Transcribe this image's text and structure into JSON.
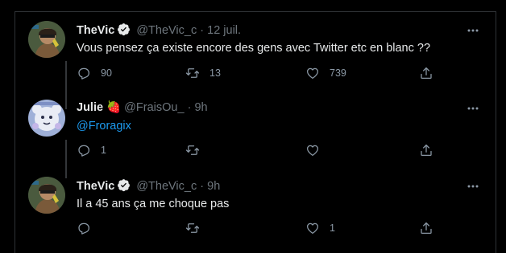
{
  "colors": {
    "background": "#000000",
    "text": "#e7e9ea",
    "secondary": "#6e767d",
    "link": "#1d9bf0",
    "verified": "#ffffff",
    "divider": "#2f3336"
  },
  "tweets": [
    {
      "name": "TheVic",
      "handle": "@TheVic_c",
      "separator": "·",
      "time": "12 juil.",
      "verified": true,
      "text": "Vous pensez ça existe encore des gens avec Twitter etc en blanc ??",
      "reply_count": "90",
      "retweet_count": "13",
      "like_count": "739",
      "icons": [
        "reply-icon",
        "retweet-icon",
        "like-icon",
        "share-icon",
        "more-icon"
      ]
    },
    {
      "name": "Julie",
      "emoji": "🍓",
      "handle": "@FraisOu_",
      "separator": "·",
      "time": "9h",
      "verified": false,
      "mention": "@Froragix",
      "reply_count": "1",
      "retweet_count": "",
      "like_count": "",
      "icons": [
        "reply-icon",
        "retweet-icon",
        "like-icon",
        "share-icon",
        "more-icon"
      ]
    },
    {
      "name": "TheVic",
      "handle": "@TheVic_c",
      "separator": "·",
      "time": "9h",
      "verified": true,
      "text": "Il a 45 ans ça me choque pas",
      "reply_count": "",
      "retweet_count": "",
      "like_count": "1",
      "icons": [
        "reply-icon",
        "retweet-icon",
        "like-icon",
        "share-icon",
        "more-icon"
      ]
    }
  ]
}
